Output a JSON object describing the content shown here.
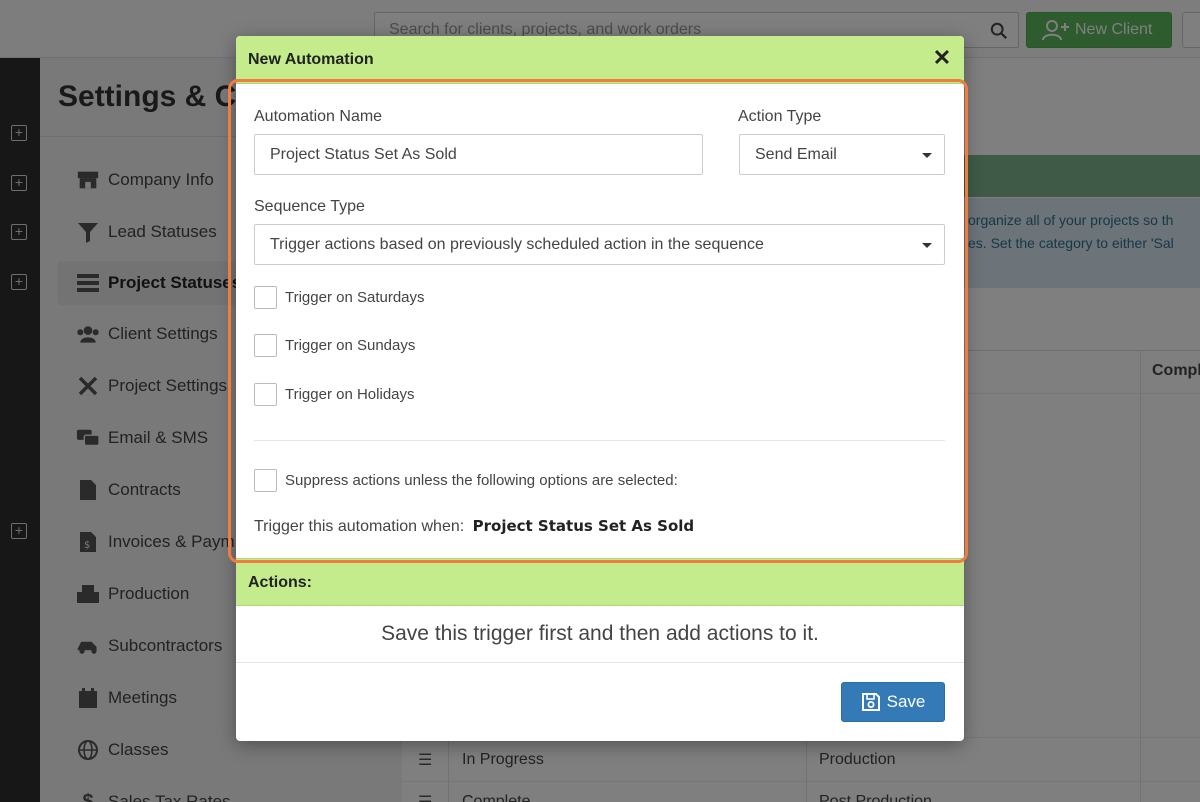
{
  "topbar": {
    "search_placeholder": "Search for clients, projects, and work orders",
    "new_client_label": "New Client"
  },
  "settings": {
    "title": "Settings & Co",
    "menu": [
      {
        "label": "Company Info",
        "icon": "store-icon"
      },
      {
        "label": "Lead Statuses",
        "icon": "funnel-icon"
      },
      {
        "label": "Project Statuses",
        "icon": "list-icon",
        "active": true
      },
      {
        "label": "Client Settings",
        "icon": "users-icon"
      },
      {
        "label": "Project Settings",
        "icon": "tools-icon"
      },
      {
        "label": "Email & SMS",
        "icon": "chat-icon"
      },
      {
        "label": "Contracts",
        "icon": "document-icon"
      },
      {
        "label": "Invoices & Paym",
        "icon": "invoice-icon"
      },
      {
        "label": "Production",
        "icon": "production-icon"
      },
      {
        "label": "Subcontractors",
        "icon": "truck-icon"
      },
      {
        "label": "Meetings",
        "icon": "calendar-icon"
      },
      {
        "label": "Classes",
        "icon": "globe-icon"
      },
      {
        "label": "Sales Tax Rates",
        "icon": "dollar-icon"
      }
    ]
  },
  "background": {
    "info_line1": "organize all of your projects so th",
    "info_line2": "es. Set the category to either 'Sal",
    "table_header_compl": "Compl",
    "rows": [
      {
        "name": "In Progress",
        "category": "Production"
      },
      {
        "name": "Complete",
        "category": "Post Production"
      }
    ]
  },
  "modal": {
    "title": "New Automation",
    "automation_name_label": "Automation Name",
    "automation_name_value": "Project Status Set As Sold",
    "action_type_label": "Action Type",
    "action_type_value": "Send Email",
    "sequence_type_label": "Sequence Type",
    "sequence_type_value": "Trigger actions based on previously scheduled action in the sequence",
    "checkboxes": [
      {
        "label": "Trigger on Saturdays",
        "checked": false
      },
      {
        "label": "Trigger on Sundays",
        "checked": false
      },
      {
        "label": "Trigger on Holidays",
        "checked": false
      }
    ],
    "suppress_label": "Suppress actions unless the following options are selected:",
    "suppress_checked": false,
    "trigger_prefix": "Trigger this automation when:",
    "trigger_value": "Project Status Set As Sold",
    "actions_title": "Actions:",
    "actions_message": "Save this trigger first and then add actions to it.",
    "save_label": "Save"
  },
  "colors": {
    "modal_header": "#c4ec8c",
    "highlight": "#ee7d3f",
    "save_button": "#337ab7",
    "new_client_button": "#5cb85c"
  }
}
